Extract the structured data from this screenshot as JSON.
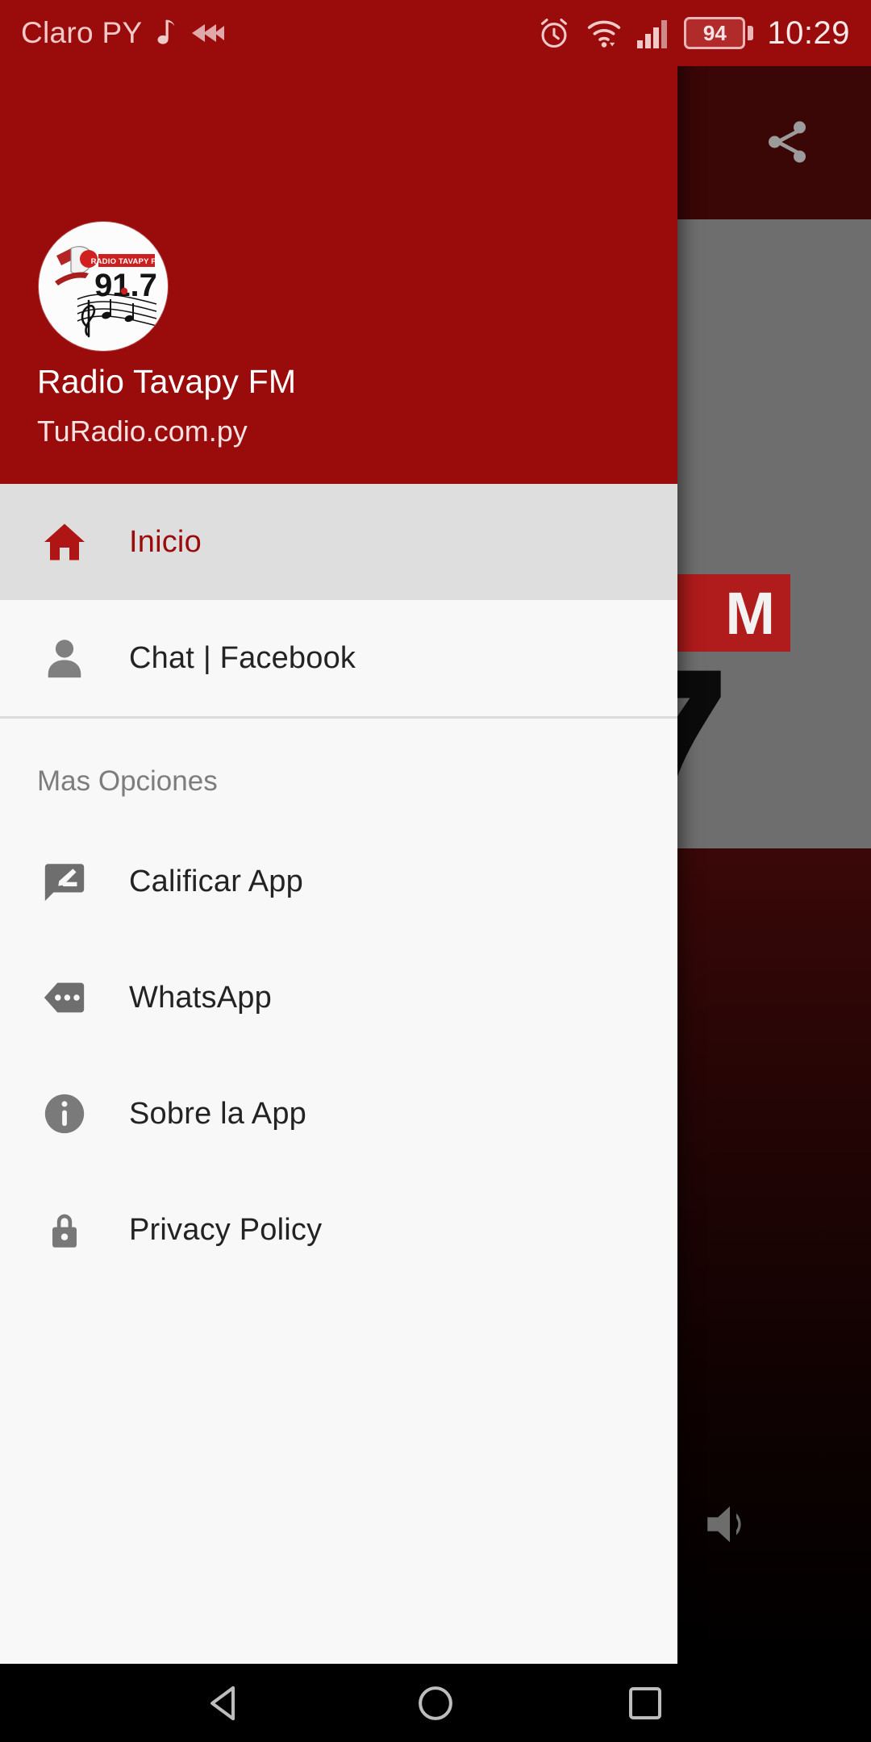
{
  "status_bar": {
    "carrier": "Claro PY",
    "music_note_icon": "music-note-icon",
    "cast_icon": "cast-rewind-icon",
    "alarm_icon": "alarm-clock-icon",
    "wifi_icon": "wifi-icon",
    "signal_icon": "cellular-signal-icon",
    "battery_percent": "94",
    "time": "10:29",
    "background_color": "#9a0b0b",
    "text_color": "#f0c9c9"
  },
  "app_background": {
    "appbar": {
      "share_icon": "share-icon",
      "background_color": "#3a0606"
    },
    "hero": {
      "fm_badge_text": "M",
      "frequency_digit": "7",
      "background_color": "#6e6e6e",
      "badge_color": "#b01b1b"
    },
    "player": {
      "volume_icon": "volume-up-icon"
    }
  },
  "drawer": {
    "header": {
      "title": "Radio Tavapy FM",
      "subtitle": "TuRadio.com.py",
      "background_color": "#9a0b0b",
      "logo": {
        "name": "radio-tavapy-logo",
        "station_name": "RADIO TAVAPY FM",
        "frequency": "91.7"
      }
    },
    "primary_items": [
      {
        "label": "Inicio",
        "icon": "home-icon",
        "selected": true,
        "icon_color": "#b01515"
      },
      {
        "label": "Chat | Facebook",
        "icon": "person-icon",
        "selected": false,
        "icon_color": "#808080"
      }
    ],
    "group_title": "Mas Opciones",
    "secondary_items": [
      {
        "label": "Calificar App",
        "icon": "rate-review-icon",
        "selected": false,
        "icon_color": "#6e6e6e"
      },
      {
        "label": "WhatsApp",
        "icon": "chat-tag-icon",
        "selected": false,
        "icon_color": "#6e6e6e"
      },
      {
        "label": "Sobre la App",
        "icon": "info-icon",
        "selected": false,
        "icon_color": "#7a7a7a"
      },
      {
        "label": "Privacy Policy",
        "icon": "lock-icon",
        "selected": false,
        "icon_color": "#787878"
      }
    ],
    "selected_row_color": "#dedede",
    "background_color": "#f8f8f8"
  },
  "system_nav": {
    "back_icon": "back-triangle-icon",
    "home_icon": "home-circle-icon",
    "recents_icon": "recents-square-icon",
    "background_color": "#000000"
  }
}
